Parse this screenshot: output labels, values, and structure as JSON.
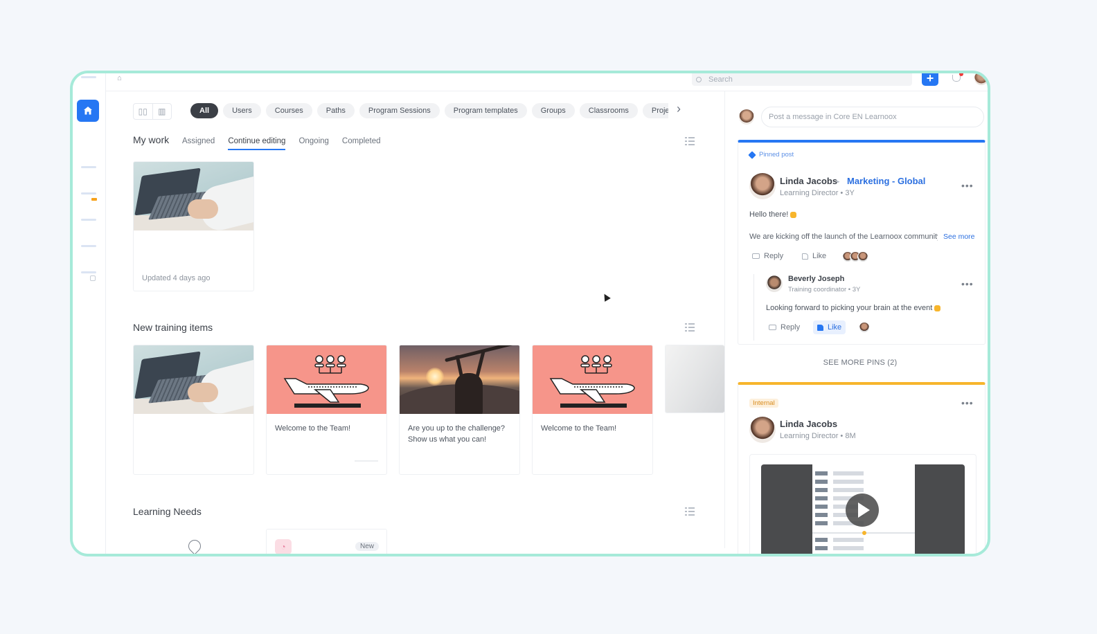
{
  "topbar": {
    "search_placeholder": "Search"
  },
  "filters": {
    "chips": [
      {
        "label": "All",
        "active": true
      },
      {
        "label": "Users"
      },
      {
        "label": "Courses"
      },
      {
        "label": "Paths"
      },
      {
        "label": "Program Sessions"
      },
      {
        "label": "Program templates"
      },
      {
        "label": "Groups"
      },
      {
        "label": "Classrooms"
      },
      {
        "label": "Proje"
      }
    ]
  },
  "my_work": {
    "title": "My work",
    "tabs": [
      "Assigned",
      "Continue editing",
      "Ongoing",
      "Completed"
    ],
    "active_tab": "Continue editing",
    "card": {
      "updated": "Updated 4 days ago"
    }
  },
  "new_training": {
    "title": "New training items",
    "cards": [
      {
        "caption": ""
      },
      {
        "caption": "Welcome to the Team!"
      },
      {
        "caption": "Are you up to the challenge? Show us what you can!"
      },
      {
        "caption": "Welcome to the Team!"
      },
      {
        "caption": ""
      }
    ]
  },
  "learning_needs": {
    "title": "Learning Needs",
    "badge": "New"
  },
  "feed": {
    "composer_placeholder": "Post a message in Core EN Learnoox",
    "pinned": {
      "label": "Pinned post",
      "author": "Linda Jacobs",
      "group": "Marketing - Global",
      "role": "Learning Director",
      "age": "3Y",
      "greeting": "Hello there!",
      "body": "We are kicking off the launch of the Learnoox community",
      "see_more": "See more",
      "reply": "Reply",
      "like": "Like",
      "comment": {
        "author": "Beverly Joseph",
        "role": "Training coordinator",
        "age": "3Y",
        "text": "Looking forward to picking your brain at the event",
        "reply": "Reply",
        "like": "Like"
      }
    },
    "see_more_pins": "SEE MORE PINS (2)",
    "internal": {
      "tag": "Internal",
      "author": "Linda Jacobs",
      "role": "Learning Director",
      "age": "8M"
    }
  },
  "colors": {
    "accent": "#2677f3",
    "frame_border": "#a6ead9",
    "pinned_bar": "#2677f3",
    "internal_bar": "#f7b52c",
    "thumb_salmon": "#f6958a"
  }
}
